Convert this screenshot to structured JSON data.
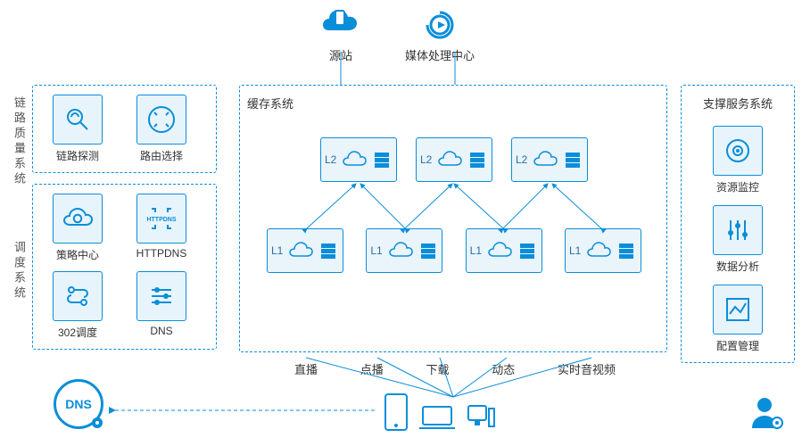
{
  "top": {
    "origin": "源站",
    "media_center": "媒体处理中心"
  },
  "left": {
    "group_a_label": "链路质量系统",
    "group_b_label": "调度系统",
    "group_a": [
      {
        "name": "link-detect",
        "label": "链路探测"
      },
      {
        "name": "route-select",
        "label": "路由选择"
      }
    ],
    "group_b": [
      {
        "name": "strategy-center",
        "label": "策略中心"
      },
      {
        "name": "httpdns",
        "label": "HTTPDNS"
      },
      {
        "name": "sched-302",
        "label": "302调度"
      },
      {
        "name": "dns",
        "label": "DNS"
      }
    ]
  },
  "center": {
    "title": "缓存系统",
    "l2": [
      "L2",
      "L2",
      "L2"
    ],
    "l1": [
      "L1",
      "L1",
      "L1",
      "L1"
    ]
  },
  "services": [
    "直播",
    "点播",
    "下载",
    "动态",
    "实时音视频"
  ],
  "right": {
    "title": "支撑服务系统",
    "items": [
      {
        "name": "resource-monitor",
        "label": "资源监控"
      },
      {
        "name": "data-analysis",
        "label": "数据分析"
      },
      {
        "name": "config-manage",
        "label": "配置管理"
      }
    ]
  },
  "bottom_dns": "DNS"
}
